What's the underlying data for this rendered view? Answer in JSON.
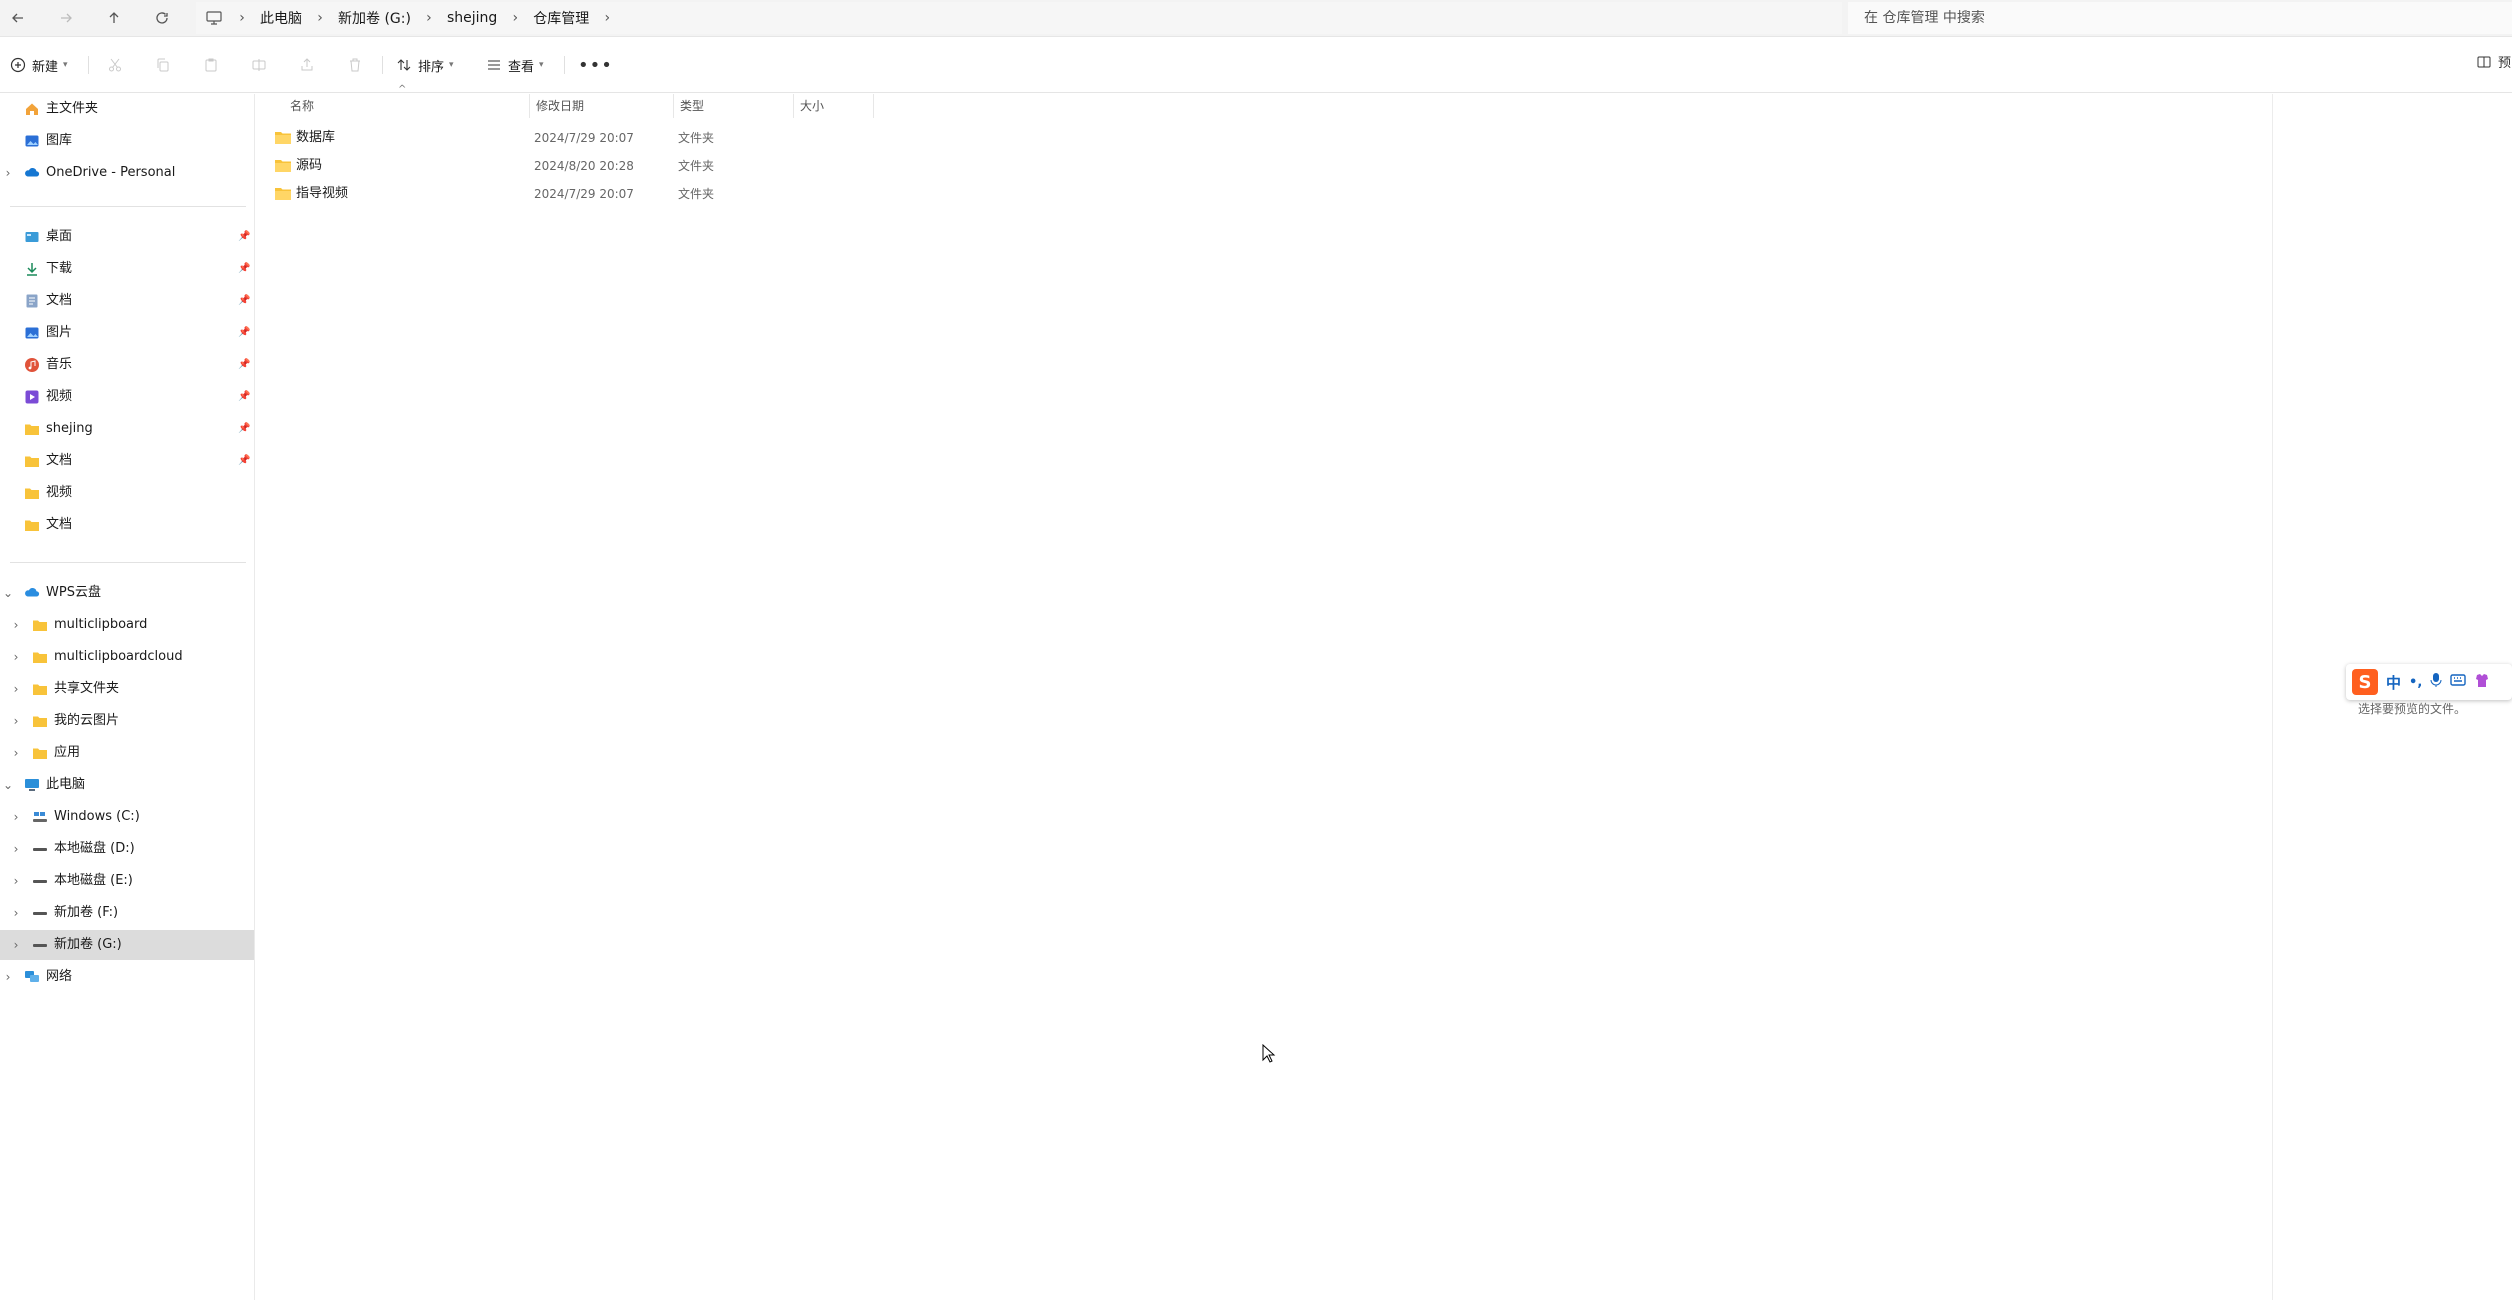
{
  "breadcrumb": [
    "此电脑",
    "新加卷 (G:)",
    "shejing",
    "仓库管理"
  ],
  "search": {
    "placeholder": "在 仓库管理 中搜索"
  },
  "toolbar": {
    "new_label": "新建",
    "sort_label": "排序",
    "view_label": "查看"
  },
  "sidebar": {
    "top": [
      "主文件夹",
      "图库",
      "OneDrive - Personal"
    ],
    "quick": [
      "桌面",
      "下载",
      "文档",
      "图片",
      "音乐",
      "视频",
      "shejing",
      "文档",
      "视频",
      "文档"
    ],
    "wps": {
      "label": "WPS云盘",
      "children": [
        "multiclipboard",
        "multiclipboardcloud",
        "共享文件夹",
        "我的云图片",
        "应用"
      ]
    },
    "pc": {
      "label": "此电脑",
      "drives": [
        "Windows (C:)",
        "本地磁盘 (D:)",
        "本地磁盘 (E:)",
        "新加卷 (F:)",
        "新加卷 (G:)"
      ]
    },
    "network": "网络"
  },
  "list": {
    "columns": {
      "name": "名称",
      "date": "修改日期",
      "type": "类型",
      "size": "大小"
    },
    "rows": [
      {
        "name": "数据库",
        "date": "2024/7/29 20:07",
        "type": "文件夹"
      },
      {
        "name": "源码",
        "date": "2024/8/20 20:28",
        "type": "文件夹"
      },
      {
        "name": "指导视频",
        "date": "2024/7/29 20:07",
        "type": "文件夹"
      }
    ]
  },
  "preview": {
    "hint": "选择要预览的文件。",
    "button_label": "预"
  },
  "ime": {
    "logo": "S",
    "mode": "中",
    "punct": "•,"
  },
  "colors": {
    "folder": "#f8c33a",
    "accent": "#0067c0",
    "selected_bg": "#dcdcdc"
  }
}
